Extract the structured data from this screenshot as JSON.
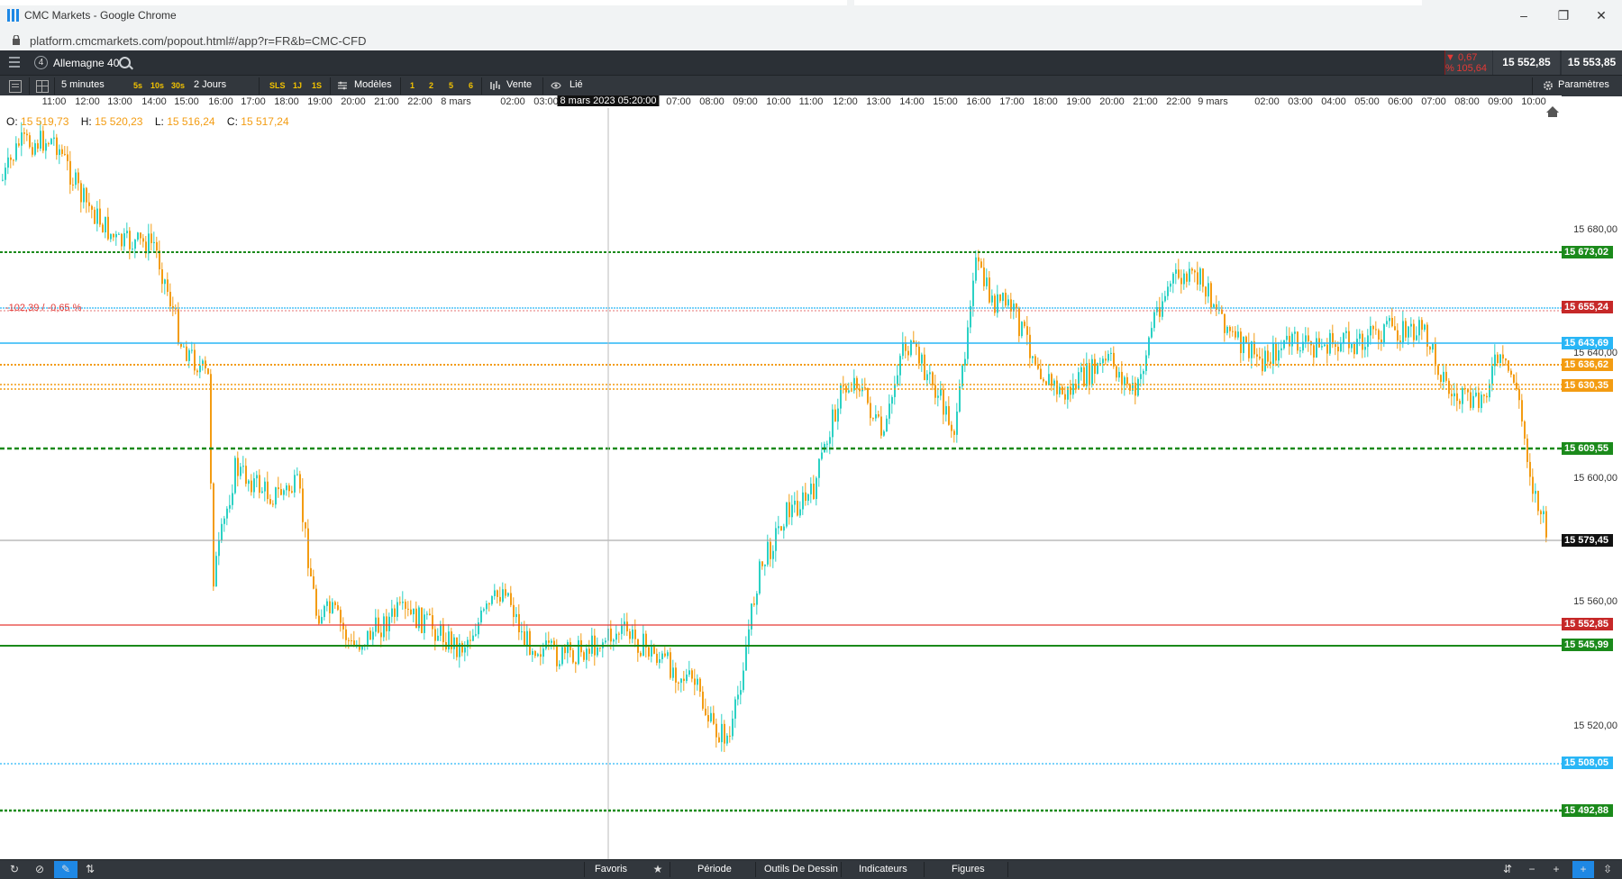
{
  "browser": {
    "window_title": "CMC Markets - Google Chrome",
    "url": "platform.cmcmarkets.com/popout.html#/app?r=FR&b=CMC-CFD"
  },
  "header": {
    "instrument_number": "4",
    "instrument_name": "Allemagne 40",
    "change_pct": "▼ 0,67 %",
    "change_abs": "105,64",
    "sell_price": "15 552,85",
    "buy_price": "15 553,85"
  },
  "toolbar": {
    "interval": "5 minutes",
    "quick_intervals": [
      "5s",
      "10s",
      "30s"
    ],
    "range": "2 Jours",
    "range_buttons": [
      "SLS",
      "1J",
      "1S"
    ],
    "templates_label": "Modèles",
    "template_numbers": [
      "1",
      "2",
      "5",
      "6"
    ],
    "side_label": "Vente",
    "linked_label": "Lié",
    "settings_label": "Paramètres"
  },
  "ohlc": {
    "o_label": "O:",
    "o": "15 519,73",
    "h_label": "H:",
    "h": "15 520,23",
    "l_label": "L:",
    "l": "15 516,24",
    "c_label": "C:",
    "c": "15 517,24"
  },
  "time_axis": {
    "labels": [
      "11:00",
      "12:00",
      "13:00",
      "14:00",
      "15:00",
      "16:00",
      "17:00",
      "18:00",
      "19:00",
      "20:00",
      "21:00",
      "22:00",
      "8 mars",
      "02:00",
      "03:00",
      "07:00",
      "08:00",
      "09:00",
      "10:00",
      "11:00",
      "12:00",
      "13:00",
      "14:00",
      "15:00",
      "16:00",
      "17:00",
      "18:00",
      "19:00",
      "20:00",
      "21:00",
      "22:00",
      "9 mars",
      "02:00",
      "03:00",
      "04:00",
      "05:00",
      "06:00",
      "07:00",
      "08:00",
      "09:00",
      "10:00"
    ],
    "cursor_time": "8 mars 2023 05:20:00"
  },
  "price_axis": {
    "ticks": [
      "15 680,00",
      "15 640,00",
      "15 600,00",
      "15 560,00",
      "15 520,00"
    ]
  },
  "level_labels": [
    {
      "text": "15 673,02",
      "color": "green"
    },
    {
      "text": "15 655,24",
      "color": "red"
    },
    {
      "text": "15 643,69",
      "color": "cyan"
    },
    {
      "text": "15 636,62",
      "color": "orange"
    },
    {
      "text": "15 630,35",
      "color": "orange"
    },
    {
      "text": "15 609,55",
      "color": "green"
    },
    {
      "text": "15 579,45",
      "color": "dark"
    },
    {
      "text": "15 552,85",
      "color": "red"
    },
    {
      "text": "15 545,99",
      "color": "green"
    },
    {
      "text": "15 508,05",
      "color": "cyan"
    },
    {
      "text": "15 492,88",
      "color": "green"
    }
  ],
  "pct_note": "-102,39 / -0,65 %",
  "bottom_bar": {
    "favorites": "Favoris",
    "period": "Période",
    "drawing_tools": "Outils De Dessin",
    "indicators": "Indicateurs",
    "figures": "Figures"
  },
  "colors": {
    "up": "#2bd1c4",
    "down": "#f39c12",
    "green_line": "#1b8a1b",
    "red_line": "#e53935",
    "cyan_line": "#29b6f6",
    "orange_line": "#f39c12"
  }
}
